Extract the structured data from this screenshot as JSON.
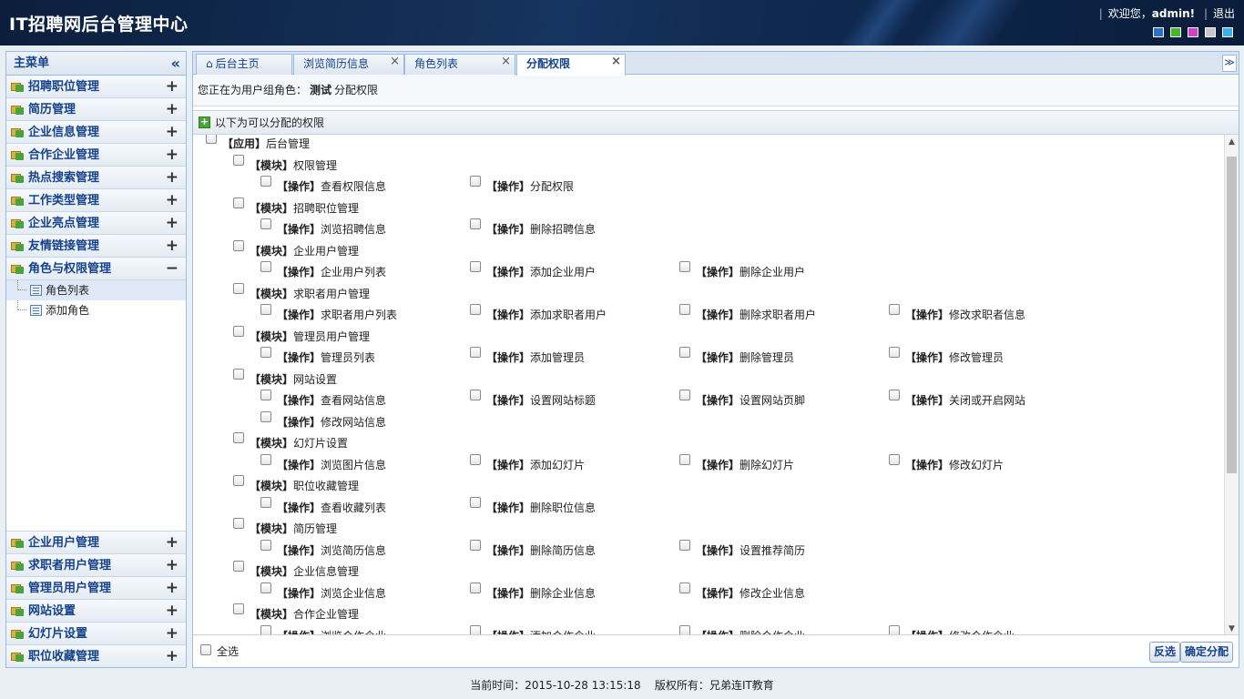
{
  "header": {
    "title": "IT招聘网后台管理中心",
    "welcome": "欢迎您，",
    "username": "admin!",
    "logout": "退出",
    "theme_colors": [
      "#2a6fcf",
      "#43b62a",
      "#d23fcb",
      "#c8c8c8",
      "#3ab0e8"
    ]
  },
  "sidebar": {
    "title": "主菜单",
    "collapse_icon": "«",
    "top_menus": [
      {
        "label": "招聘职位管理",
        "toggle": "+"
      },
      {
        "label": "简历管理",
        "toggle": "+"
      },
      {
        "label": "企业信息管理",
        "toggle": "+"
      },
      {
        "label": "合作企业管理",
        "toggle": "+"
      },
      {
        "label": "热点搜索管理",
        "toggle": "+"
      },
      {
        "label": "工作类型管理",
        "toggle": "+"
      },
      {
        "label": "企业亮点管理",
        "toggle": "+"
      },
      {
        "label": "友情链接管理",
        "toggle": "+"
      },
      {
        "label": "角色与权限管理",
        "toggle": "−"
      }
    ],
    "sub_items": [
      {
        "label": "角色列表",
        "active": true
      },
      {
        "label": "添加角色",
        "active": false
      }
    ],
    "bottom_menus": [
      {
        "label": "企业用户管理",
        "toggle": "+"
      },
      {
        "label": "求职者用户管理",
        "toggle": "+"
      },
      {
        "label": "管理员用户管理",
        "toggle": "+"
      },
      {
        "label": "网站设置",
        "toggle": "+"
      },
      {
        "label": "幻灯片设置",
        "toggle": "+"
      },
      {
        "label": "职位收藏管理",
        "toggle": "+"
      }
    ]
  },
  "tabs": [
    {
      "label": "后台主页",
      "closable": false,
      "home": true
    },
    {
      "label": "浏览简历信息",
      "closable": true
    },
    {
      "label": "角色列表",
      "closable": true
    },
    {
      "label": "分配权限",
      "closable": true,
      "active": true
    }
  ],
  "tab_scroll_icon": "≫",
  "notice": {
    "prefix": "您正在为用户组角色：",
    "role": "测试",
    "suffix": "分配权限"
  },
  "perm_title": "以下为可以分配的权限",
  "app": {
    "tag": "【应用】",
    "label": "后台管理"
  },
  "module_tag": "【模块】",
  "op_tag": "【操作】",
  "modules": [
    {
      "label": "权限管理",
      "ops": [
        "查看权限信息",
        "分配权限"
      ]
    },
    {
      "label": "招聘职位管理",
      "ops": [
        "浏览招聘信息",
        "删除招聘信息"
      ]
    },
    {
      "label": "企业用户管理",
      "ops": [
        "企业用户列表",
        "添加企业用户",
        "删除企业用户"
      ]
    },
    {
      "label": "求职者用户管理",
      "ops": [
        "求职者用户列表",
        "添加求职者用户",
        "删除求职者用户",
        "修改求职者信息"
      ]
    },
    {
      "label": "管理员用户管理",
      "ops": [
        "管理员列表",
        "添加管理员",
        "删除管理员",
        "修改管理员"
      ]
    },
    {
      "label": "网站设置",
      "ops": [
        "查看网站信息",
        "设置网站标题",
        "设置网站页脚",
        "关闭或开启网站",
        "修改网站信息"
      ]
    },
    {
      "label": "幻灯片设置",
      "ops": [
        "浏览图片信息",
        "添加幻灯片",
        "删除幻灯片",
        "修改幻灯片"
      ]
    },
    {
      "label": "职位收藏管理",
      "ops": [
        "查看收藏列表",
        "删除职位信息"
      ]
    },
    {
      "label": "简历管理",
      "ops": [
        "浏览简历信息",
        "删除简历信息",
        "设置推荐简历"
      ]
    },
    {
      "label": "企业信息管理",
      "ops": [
        "浏览企业信息",
        "删除企业信息",
        "修改企业信息"
      ]
    },
    {
      "label": "合作企业管理",
      "ops": [
        "浏览合作企业",
        "添加合作企业",
        "删除合作企业",
        "修改合作企业"
      ]
    }
  ],
  "footer_bar": {
    "select_all": "全选",
    "invert": "反选",
    "confirm": "确定分配"
  },
  "page_footer": {
    "time_label": "当前时间：",
    "time": "2015-10-28 13:15:18",
    "copyright_label": "版权所有：",
    "copyright": "兄弟连IT教育"
  }
}
